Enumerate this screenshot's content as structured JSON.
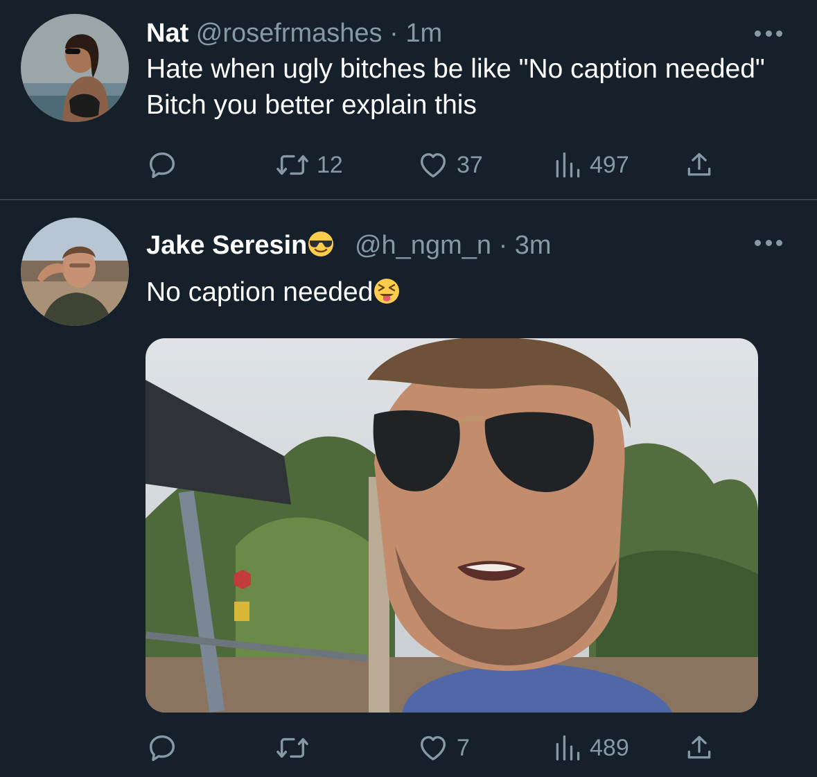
{
  "tweets": [
    {
      "display_name": "Nat",
      "handle": "@rosefrmashes",
      "separator": "·",
      "time": "1m",
      "text": "Hate when ugly bitches be like \"No caption needed\" Bitch you better explain this",
      "actions": {
        "reply_count": "",
        "retweet_count": "12",
        "like_count": "37",
        "views_count": "497"
      }
    },
    {
      "display_name": "Jake Seresin",
      "name_emoji": "smiling-face-with-sunglasses",
      "handle": "@h_ngm_n",
      "separator": "·",
      "time": "3m",
      "text": "No caption needed",
      "text_emoji": "squinting-face-with-tongue",
      "media": "selfie-photo",
      "actions": {
        "reply_count": "",
        "retweet_count": "",
        "like_count": "7",
        "views_count": "489"
      }
    }
  ],
  "icons": {
    "reply": "reply-icon",
    "retweet": "retweet-icon",
    "like": "heart-icon",
    "views": "views-icon",
    "share": "share-icon",
    "more": "more-icon"
  },
  "colors": {
    "background": "#15202b",
    "divider": "#38444d",
    "secondary_text": "#8899a6",
    "primary_text": "#ffffff"
  }
}
